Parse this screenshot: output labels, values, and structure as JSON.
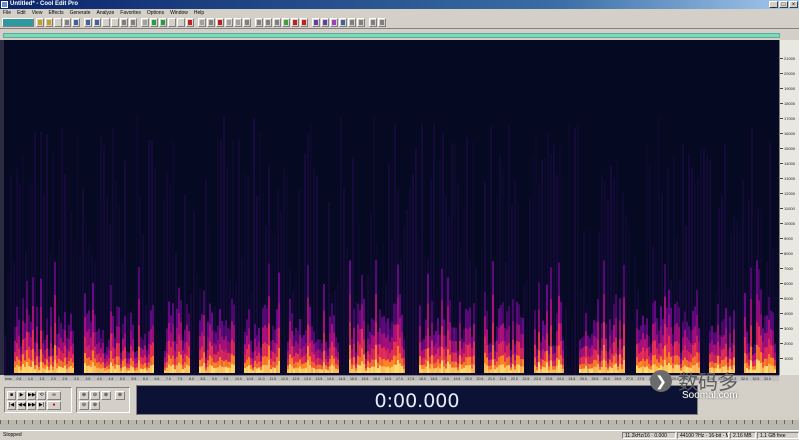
{
  "window": {
    "title": "Untitled* - Cool Edit Pro",
    "min_glyph": "_",
    "max_glyph": "□",
    "close_glyph": "×"
  },
  "menu": [
    "File",
    "Edit",
    "View",
    "Effects",
    "Generate",
    "Analyze",
    "Favorites",
    "Options",
    "Window",
    "Help"
  ],
  "toolbar": {
    "button_colors": [
      "#2e9aa0",
      "#c8a020",
      "#c8a020",
      "#d4d0c8",
      "#808080",
      "#4060a0",
      "#4060a0",
      "#4060a0",
      "#d4d0c8",
      "#d4d0c8",
      "#808080",
      "#808080",
      "#a0a0a0",
      "#20a040",
      "#20a040",
      "#d4d0c8",
      "#d4d0c8",
      "#c02020",
      "#a0a0a0",
      "#808080",
      "#c02020",
      "#a0a0a0",
      "#a0a0a0",
      "#808080",
      "#808080",
      "#808080",
      "#808080",
      "#40a040",
      "#c02020",
      "#c02020",
      "#6040a0",
      "#6040a0",
      "#a040c0",
      "#4060a0",
      "#808080",
      "#808080",
      "#808080",
      "#808080"
    ]
  },
  "spectrogram": {
    "bg_color": "#050a22",
    "heat_colors": [
      "#2a0a55",
      "#6a0a8a",
      "#b0107a",
      "#e83050",
      "#ff8a20",
      "#ffe070"
    ]
  },
  "freq_ruler": {
    "labels": [
      "21000",
      "20000",
      "19000",
      "18000",
      "17000",
      "16000",
      "15000",
      "14000",
      "13000",
      "12000",
      "11000",
      "10000",
      "9000",
      "8000",
      "7000",
      "6000",
      "5000",
      "4000",
      "3000",
      "2000",
      "1000"
    ]
  },
  "time_ruler": {
    "labels": [
      "hms",
      "0.5",
      "1.0",
      "1.5",
      "2.0",
      "2.5",
      "3.0",
      "3.5",
      "4.0",
      "4.5",
      "5.0",
      "5.5",
      "6.0",
      "6.5",
      "7.0",
      "7.5",
      "8.0",
      "8.5",
      "9.0",
      "9.5",
      "10.0",
      "10.5",
      "11.0",
      "11.5",
      "12.0",
      "12.5",
      "13.0",
      "13.5",
      "14.0",
      "14.5",
      "15.0",
      "15.5",
      "16.0",
      "16.5",
      "17.0",
      "17.5",
      "18.0",
      "18.5",
      "19.0",
      "19.5",
      "20.0",
      "20.5",
      "21.0",
      "21.5",
      "22.0",
      "22.5",
      "23.0",
      "23.5",
      "24.0",
      "24.5",
      "25.0",
      "25.5",
      "26.0",
      "26.5",
      "27.0",
      "27.5",
      "28.0",
      "28.5",
      "29.0",
      "29.5",
      "30.0",
      "30.5",
      "31.0",
      "31.5",
      "32.0",
      "32.5",
      "33.0"
    ]
  },
  "transport": {
    "buttons": [
      "■",
      "▶",
      "▶▶",
      "⟲",
      "∞",
      "|◀",
      "◀◀",
      "▶▶",
      "▶|",
      "●"
    ]
  },
  "zoom": {
    "buttons": [
      "⊕",
      "⊖",
      "⊕",
      "⊕",
      "⊖",
      "⊕"
    ]
  },
  "time_display": "0:00.000",
  "watermark": {
    "logo": "❯",
    "cn": "数码多",
    "url": "Soomal.com"
  },
  "status": {
    "main": "Stopped",
    "cells": [
      "11.2kHz/16 · 0.000",
      "44100 ?Hz · 16-bit · Mono",
      "2.16 MB",
      "1.1 GB free"
    ]
  }
}
